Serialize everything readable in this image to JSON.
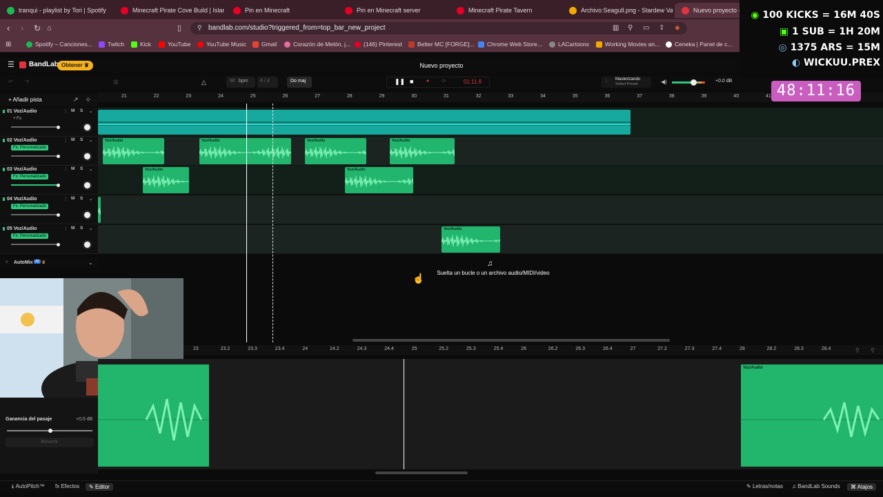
{
  "browser": {
    "tabs": [
      {
        "label": "tranqui - playlist by Tori | Spotify",
        "color": "#1db954"
      },
      {
        "label": "Minecraft Pirate Cove Build | Island /",
        "color": "#e60023"
      },
      {
        "label": "Pin en Minecraft",
        "color": "#e60023"
      },
      {
        "label": "Pin en Minecraft server",
        "color": "#e60023"
      },
      {
        "label": "Minecraft Pirate Tavern",
        "color": "#e60023"
      },
      {
        "label": "Archivo:Seagull.png - Stardew Valley",
        "color": "#f2a900"
      },
      {
        "label": "Nuevo proyecto -",
        "color": "#e0323c"
      }
    ],
    "url": "bandlab.com/studio?triggered_from=top_bar_new_project",
    "bookmarks": [
      {
        "label": "Spotify – Canciones...",
        "color": "#1db954"
      },
      {
        "label": "Twitch",
        "color": "#9146ff"
      },
      {
        "label": "Kick",
        "color": "#53fc18"
      },
      {
        "label": "YouTube",
        "color": "#ff0000"
      },
      {
        "label": "YouTube Music",
        "color": "#ff0000"
      },
      {
        "label": "Gmail",
        "color": "#ea4335"
      },
      {
        "label": "Corazón de Melón, j...",
        "color": "#e86aa0"
      },
      {
        "label": "(146) Pinterest",
        "color": "#e60023"
      },
      {
        "label": "Better MC [FORGE]...",
        "color": "#c0392b"
      },
      {
        "label": "Chrome Web Store...",
        "color": "#4285f4"
      },
      {
        "label": "LACartoons",
        "color": "#888888"
      },
      {
        "label": "Working Movies an...",
        "color": "#f2a900"
      },
      {
        "label": "Ceneka | Panel de c...",
        "color": "#ffffff"
      }
    ]
  },
  "app": {
    "logo": "BandLab",
    "obtener": "Obtener",
    "project_title": "Nuevo proyecto",
    "bpm_value": "90",
    "bpm_label": "bpm",
    "time_sig": "4 / 4",
    "key": "Do maj",
    "time": "01:11.8",
    "mastering_label": "Masterizando",
    "mastering_sub": "Select Preset",
    "master_db": "+0.0 dB",
    "add_track": "Añadir pista",
    "ruler": [
      "21",
      "22",
      "23",
      "24",
      "25",
      "26",
      "27",
      "28",
      "29",
      "30",
      "31",
      "32",
      "33",
      "34",
      "35",
      "36",
      "37",
      "38",
      "39",
      "40",
      "41"
    ],
    "tracks": [
      {
        "name": "01  Voz/Audio",
        "fx": "+ Fx",
        "fx_active": false
      },
      {
        "name": "02  Voz/Audio",
        "fx": "Fx: Personalizado",
        "fx_active": true
      },
      {
        "name": "03  Voz/Audio",
        "fx": "Fx: Personalizado",
        "fx_active": true
      },
      {
        "name": "04  Voz/Audio",
        "fx": "Fx: Personalizado",
        "fx_active": true
      },
      {
        "name": "05  Voz/Audio",
        "fx": "Fx: Personalizado",
        "fx_active": true
      }
    ],
    "mute": "M",
    "solo": "S",
    "clip_label": "Voz/Audio",
    "automix": "AutoMix",
    "drop_hint": "Suelta un bucle o un archivo audio/MIDI/video",
    "editor_ruler": [
      "23",
      "23.2",
      "23.3",
      "23.4",
      "24",
      "24.2",
      "24.3",
      "24.4",
      "25",
      "25.2",
      "25.3",
      "25.4",
      "26",
      "26.2",
      "26.3",
      "26.4",
      "27",
      "27.2",
      "27.3",
      "27.4",
      "28",
      "28.2",
      "28.3",
      "28.4"
    ],
    "gain_label": "Ganancia del pasaje",
    "gain_value": "+0.0 dB",
    "revert": "Revertir",
    "bottom_left": [
      "AutoPitch™",
      "Efectos",
      "Editor"
    ],
    "bottom_right": [
      "Letras/notas",
      "BandLab Sounds",
      "Atajos"
    ]
  },
  "overlay": {
    "lines": [
      "100 KICKS = 16M 40S",
      "1 SUB = 1H 20M",
      "1375 ARS = 15M",
      "WICKUU.PREX"
    ],
    "timer": "48:11:16"
  }
}
